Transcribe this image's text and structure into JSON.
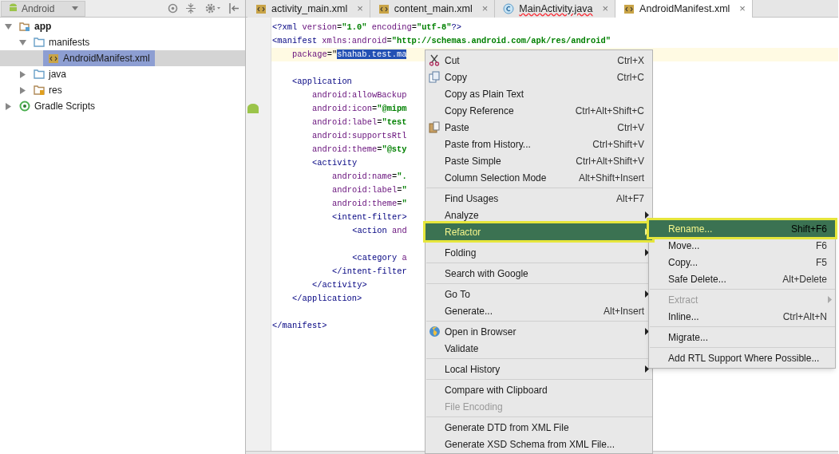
{
  "project_panel": {
    "view_selector": "Android",
    "tree": [
      {
        "label": "app",
        "kind": "module",
        "bold": true,
        "expanded": true,
        "selected": false,
        "children": [
          {
            "label": "manifests",
            "kind": "folder",
            "bold": false,
            "expanded": true,
            "selected": false,
            "children": [
              {
                "label": "AndroidManifest.xml",
                "kind": "xml",
                "bold": false,
                "selected": true
              }
            ]
          },
          {
            "label": "java",
            "kind": "folder",
            "bold": false,
            "expanded": false,
            "selected": false
          },
          {
            "label": "res",
            "kind": "res",
            "bold": false,
            "expanded": false,
            "selected": false
          }
        ]
      },
      {
        "label": "Gradle Scripts",
        "kind": "gradle",
        "bold": false,
        "expanded": false,
        "selected": false
      }
    ]
  },
  "tabs": [
    {
      "label": "activity_main.xml",
      "kind": "xml",
      "selected": false,
      "error": false
    },
    {
      "label": "content_main.xml",
      "kind": "xml",
      "selected": false,
      "error": false
    },
    {
      "label": "MainActivity.java",
      "kind": "class",
      "selected": false,
      "error": true
    },
    {
      "label": "AndroidManifest.xml",
      "kind": "xml",
      "selected": true,
      "error": false
    }
  ],
  "tab_close": "×",
  "editor": {
    "lines": [
      {
        "kind": "code",
        "segments": [
          {
            "kind": "tag",
            "text": "<?xml"
          },
          {
            "kind": "attr",
            "text": " version"
          },
          {
            "kind": "plain",
            "text": "="
          },
          {
            "kind": "value",
            "text": "\"1.0\""
          },
          {
            "kind": "attr",
            "text": " encoding"
          },
          {
            "kind": "plain",
            "text": "="
          },
          {
            "kind": "value",
            "text": "\"utf-8\""
          },
          {
            "kind": "tag",
            "text": "?>"
          }
        ]
      },
      {
        "kind": "code",
        "segments": [
          {
            "kind": "tag",
            "text": "<manifest"
          },
          {
            "kind": "attr",
            "text": " xmlns:android"
          },
          {
            "kind": "plain",
            "text": "="
          },
          {
            "kind": "value",
            "text": "\"http://schemas.android.com/apk/res/android\""
          }
        ],
        "children": [
          {
            "kind": "code",
            "current": true,
            "segments": [
              {
                "kind": "attr",
                "text": "package"
              },
              {
                "kind": "plain",
                "text": "=\""
              },
              {
                "kind": "selection",
                "text": "shahab.test.ma"
              }
            ]
          },
          {
            "kind": "blank"
          },
          {
            "kind": "code",
            "segments": [
              {
                "kind": "tag",
                "text": "<application"
              }
            ],
            "children": [
              {
                "kind": "code",
                "segments": [
                  {
                    "kind": "attr",
                    "text": "android:allowBackup"
                  }
                ]
              },
              {
                "kind": "code",
                "segments": [
                  {
                    "kind": "attr",
                    "text": "android:icon"
                  },
                  {
                    "kind": "plain",
                    "text": "="
                  },
                  {
                    "kind": "value",
                    "text": "\"@mipm"
                  }
                ]
              },
              {
                "kind": "code",
                "segments": [
                  {
                    "kind": "attr",
                    "text": "android:label"
                  },
                  {
                    "kind": "plain",
                    "text": "="
                  },
                  {
                    "kind": "value",
                    "text": "\"test"
                  }
                ]
              },
              {
                "kind": "code",
                "segments": [
                  {
                    "kind": "attr",
                    "text": "android:supportsRtl"
                  }
                ]
              },
              {
                "kind": "code",
                "segments": [
                  {
                    "kind": "attr",
                    "text": "android:theme"
                  },
                  {
                    "kind": "plain",
                    "text": "="
                  },
                  {
                    "kind": "value",
                    "text": "\"@sty"
                  }
                ]
              },
              {
                "kind": "code",
                "segments": [
                  {
                    "kind": "tag",
                    "text": "<activity"
                  }
                ],
                "children": [
                  {
                    "kind": "code",
                    "segments": [
                      {
                        "kind": "attr",
                        "text": "android:name"
                      },
                      {
                        "kind": "plain",
                        "text": "="
                      },
                      {
                        "kind": "value",
                        "text": "\"."
                      }
                    ]
                  },
                  {
                    "kind": "code",
                    "segments": [
                      {
                        "kind": "attr",
                        "text": "android:label"
                      },
                      {
                        "kind": "plain",
                        "text": "="
                      },
                      {
                        "kind": "value",
                        "text": "\""
                      }
                    ]
                  },
                  {
                    "kind": "code",
                    "segments": [
                      {
                        "kind": "attr",
                        "text": "android:theme"
                      },
                      {
                        "kind": "plain",
                        "text": "="
                      },
                      {
                        "kind": "value",
                        "text": "\""
                      }
                    ]
                  },
                  {
                    "kind": "code",
                    "segments": [
                      {
                        "kind": "tag",
                        "text": "<intent-filter>"
                      }
                    ],
                    "children": [
                      {
                        "kind": "code",
                        "segments": [
                          {
                            "kind": "tag",
                            "text": "<action"
                          },
                          {
                            "kind": "attr",
                            "text": " and"
                          }
                        ]
                      },
                      {
                        "kind": "blank"
                      },
                      {
                        "kind": "code",
                        "segments": [
                          {
                            "kind": "tag",
                            "text": "<category"
                          },
                          {
                            "kind": "attr",
                            "text": " a"
                          }
                        ]
                      }
                    ]
                  },
                  {
                    "kind": "code",
                    "segments": [
                      {
                        "kind": "tag",
                        "text": "</intent-filter"
                      }
                    ]
                  }
                ]
              },
              {
                "kind": "code",
                "segments": [
                  {
                    "kind": "tag",
                    "text": "</activity>"
                  }
                ]
              }
            ]
          },
          {
            "kind": "code",
            "segments": [
              {
                "kind": "tag",
                "text": "</application>"
              }
            ]
          },
          {
            "kind": "blank"
          }
        ]
      },
      {
        "kind": "code",
        "segments": [
          {
            "kind": "tag",
            "text": "</manifest>"
          }
        ]
      }
    ]
  },
  "context_menu": [
    {
      "kind": "cut",
      "label": "Cut",
      "shortcut": "Ctrl+X",
      "submenu": false,
      "disabled": false,
      "selected": false
    },
    {
      "kind": "copy",
      "label": "Copy",
      "shortcut": "Ctrl+C",
      "submenu": false,
      "disabled": false,
      "selected": false
    },
    {
      "kind": "item",
      "label": "Copy as Plain Text",
      "submenu": false,
      "disabled": false,
      "selected": false
    },
    {
      "kind": "item",
      "label": "Copy Reference",
      "shortcut": "Ctrl+Alt+Shift+C",
      "submenu": false,
      "disabled": false,
      "selected": false
    },
    {
      "kind": "paste",
      "label": "Paste",
      "shortcut": "Ctrl+V",
      "submenu": false,
      "disabled": false,
      "selected": false
    },
    {
      "kind": "item",
      "label": "Paste from History...",
      "shortcut": "Ctrl+Shift+V",
      "submenu": false,
      "disabled": false,
      "selected": false
    },
    {
      "kind": "item",
      "label": "Paste Simple",
      "shortcut": "Ctrl+Alt+Shift+V",
      "submenu": false,
      "disabled": false,
      "selected": false
    },
    {
      "kind": "item",
      "label": "Column Selection Mode",
      "shortcut": "Alt+Shift+Insert",
      "submenu": false,
      "disabled": false,
      "selected": false
    },
    {
      "kind": "separator"
    },
    {
      "kind": "item",
      "label": "Find Usages",
      "shortcut": "Alt+F7",
      "submenu": false,
      "disabled": false,
      "selected": false
    },
    {
      "kind": "item",
      "label": "Analyze",
      "submenu": true,
      "disabled": false,
      "selected": false
    },
    {
      "kind": "item",
      "label": "Refactor",
      "submenu": true,
      "disabled": false,
      "selected": true
    },
    {
      "kind": "separator"
    },
    {
      "kind": "item",
      "label": "Folding",
      "submenu": true,
      "disabled": false,
      "selected": false
    },
    {
      "kind": "separator"
    },
    {
      "kind": "item",
      "label": "Search with Google",
      "submenu": false,
      "disabled": false,
      "selected": false
    },
    {
      "kind": "separator"
    },
    {
      "kind": "item",
      "label": "Go To",
      "submenu": true,
      "disabled": false,
      "selected": false
    },
    {
      "kind": "item",
      "label": "Generate...",
      "shortcut": "Alt+Insert",
      "submenu": false,
      "disabled": false,
      "selected": false
    },
    {
      "kind": "separator"
    },
    {
      "kind": "browser",
      "label": "Open in Browser",
      "submenu": true,
      "disabled": false,
      "selected": false
    },
    {
      "kind": "item",
      "label": "Validate",
      "submenu": false,
      "disabled": false,
      "selected": false
    },
    {
      "kind": "separator"
    },
    {
      "kind": "item",
      "label": "Local History",
      "submenu": true,
      "disabled": false,
      "selected": false
    },
    {
      "kind": "separator"
    },
    {
      "kind": "item",
      "label": "Compare with Clipboard",
      "submenu": false,
      "disabled": false,
      "selected": false
    },
    {
      "kind": "item",
      "label": "File Encoding",
      "submenu": false,
      "disabled": true,
      "selected": false
    },
    {
      "kind": "separator"
    },
    {
      "kind": "item",
      "label": "Generate DTD from XML File",
      "submenu": false,
      "disabled": false,
      "selected": false
    },
    {
      "kind": "item",
      "label": "Generate XSD Schema from XML File...",
      "submenu": false,
      "disabled": false,
      "selected": false
    }
  ],
  "refactor_submenu": [
    {
      "kind": "item",
      "label": "Rename...",
      "shortcut": "Shift+F6",
      "submenu": false,
      "disabled": false,
      "selected": true
    },
    {
      "kind": "item",
      "label": "Move...",
      "shortcut": "F6",
      "submenu": false,
      "disabled": false,
      "selected": false
    },
    {
      "kind": "item",
      "label": "Copy...",
      "shortcut": "F5",
      "submenu": false,
      "disabled": false,
      "selected": false
    },
    {
      "kind": "item",
      "label": "Safe Delete...",
      "shortcut": "Alt+Delete",
      "submenu": false,
      "disabled": false,
      "selected": false
    },
    {
      "kind": "separator"
    },
    {
      "kind": "item",
      "label": "Extract",
      "submenu": true,
      "disabled": true,
      "selected": false
    },
    {
      "kind": "item",
      "label": "Inline...",
      "shortcut": "Ctrl+Alt+N",
      "submenu": false,
      "disabled": false,
      "selected": false
    },
    {
      "kind": "separator"
    },
    {
      "kind": "item",
      "label": "Migrate...",
      "submenu": false,
      "disabled": false,
      "selected": false
    },
    {
      "kind": "separator"
    },
    {
      "kind": "item",
      "label": "Add RTL Support Where Possible...",
      "submenu": false,
      "disabled": false,
      "selected": false
    }
  ]
}
